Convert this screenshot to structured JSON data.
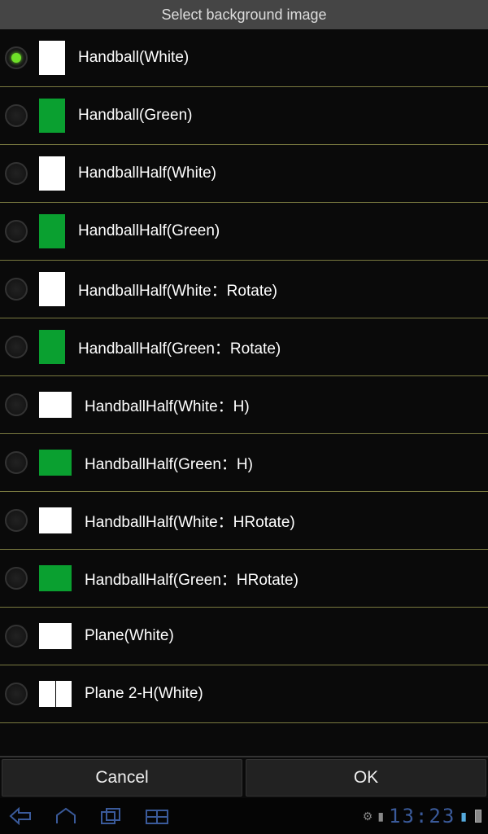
{
  "title": "Select background image",
  "items": [
    {
      "label": "Handball(White)",
      "thumb": "white",
      "selected": true
    },
    {
      "label": "Handball(Green)",
      "thumb": "green",
      "selected": false
    },
    {
      "label": "HandballHalf(White)",
      "thumb": "white",
      "selected": false
    },
    {
      "label": "HandballHalf(Green)",
      "thumb": "green",
      "selected": false
    },
    {
      "label": "HandballHalf(White：Rotate)",
      "thumb": "white",
      "selected": false
    },
    {
      "label": "HandballHalf(Green：Rotate)",
      "thumb": "green",
      "selected": false
    },
    {
      "label": "HandballHalf(White：H)",
      "thumb": "white-wide",
      "selected": false
    },
    {
      "label": "HandballHalf(Green：H)",
      "thumb": "green-wide",
      "selected": false
    },
    {
      "label": "HandballHalf(White：HRotate)",
      "thumb": "white-wide",
      "selected": false
    },
    {
      "label": "HandballHalf(Green：HRotate)",
      "thumb": "green-wide",
      "selected": false
    },
    {
      "label": "Plane(White)",
      "thumb": "white-wide",
      "selected": false
    },
    {
      "label": "Plane 2-H(White)",
      "thumb": "white-wide-lines",
      "selected": false
    }
  ],
  "buttons": {
    "cancel": "Cancel",
    "ok": "OK"
  },
  "status": {
    "time": "13:23"
  }
}
